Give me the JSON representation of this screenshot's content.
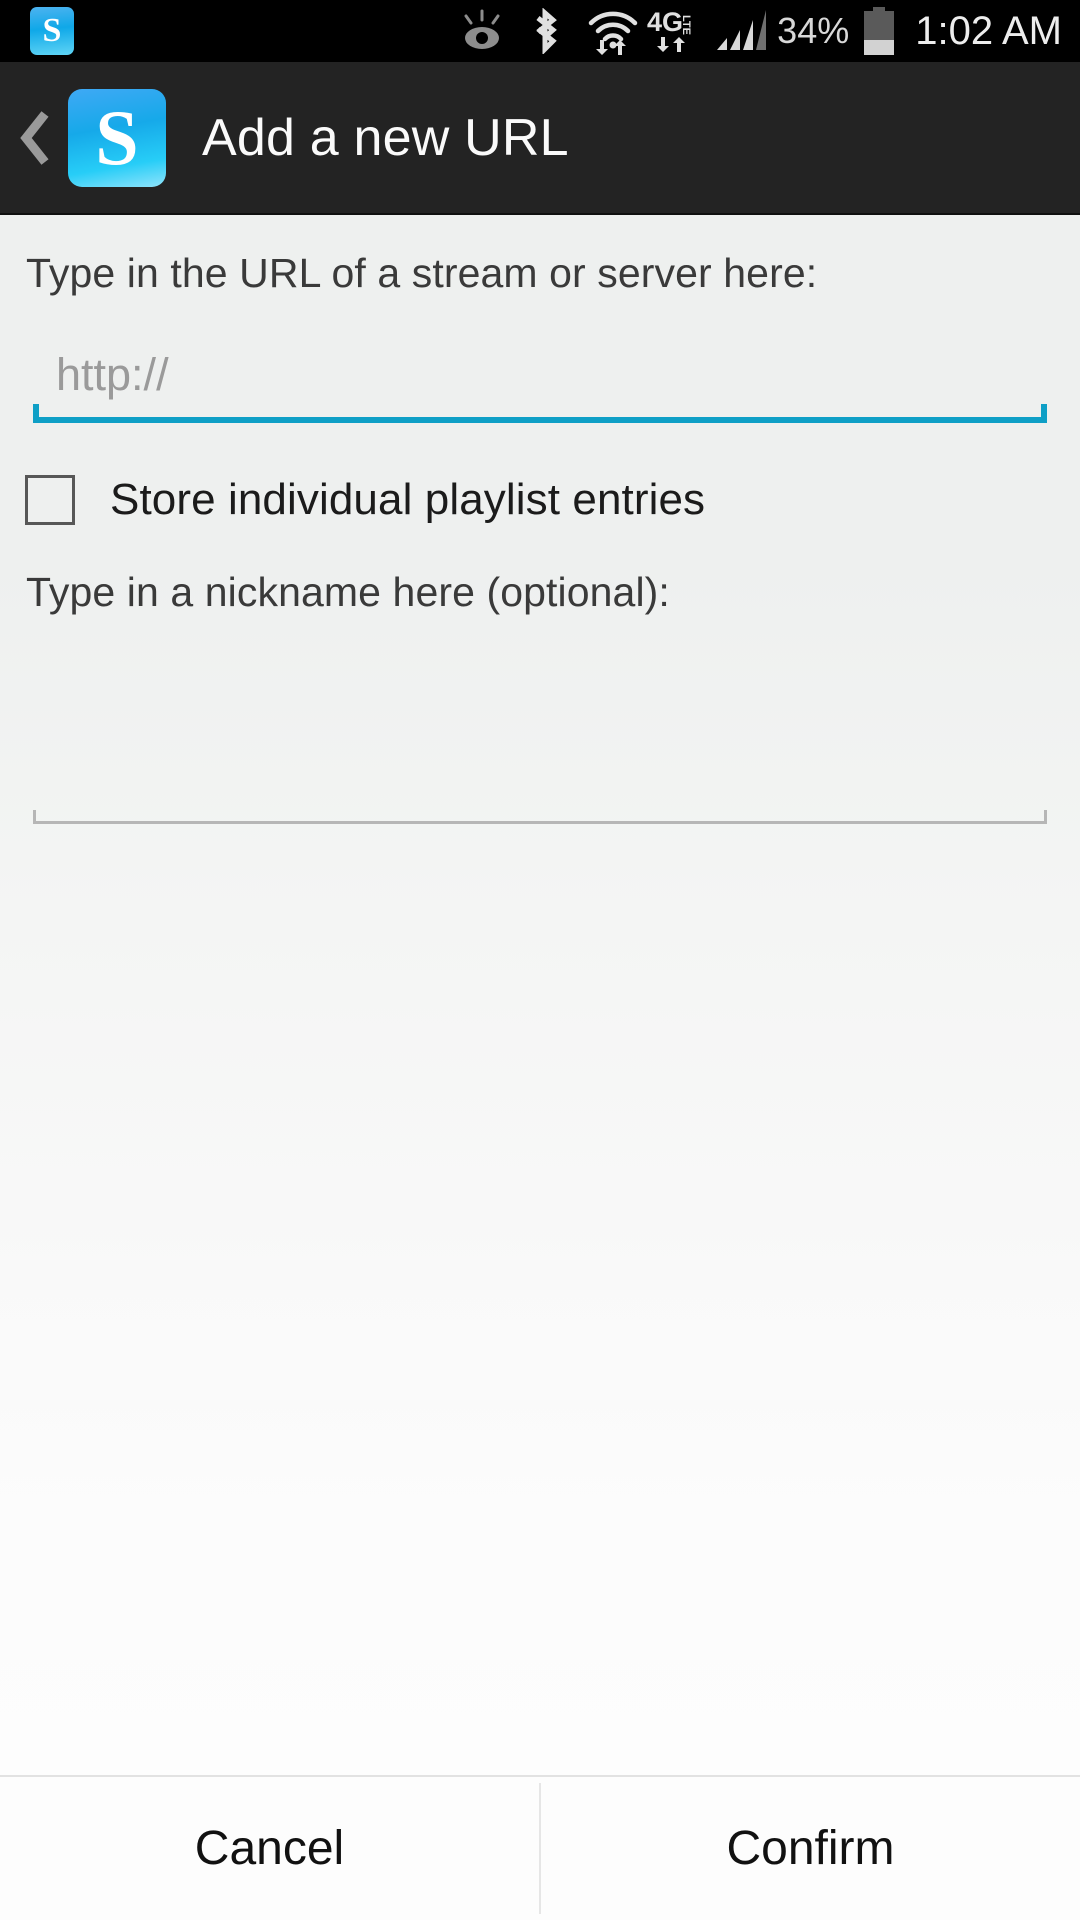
{
  "status_bar": {
    "app_icon": "servestream-notification-icon",
    "app_icon_letter": "S",
    "icons": [
      "smart-stay-eye-icon",
      "bluetooth-icon",
      "wifi-icon",
      "4g-lte-icon",
      "signal-bars-icon"
    ],
    "battery_percent": "34%",
    "battery_level": 34,
    "time": "1:02 AM",
    "lte_label": "4G",
    "lte_sublabel": "LTE",
    "background": "#000000"
  },
  "action_bar": {
    "back_icon": "back-chevron-icon",
    "app_icon": "servestream-app-icon",
    "app_icon_letter": "S",
    "title": "Add a new URL",
    "background": "#232323"
  },
  "form": {
    "url_label": "Type in the URL of a stream or server here:",
    "url_input": {
      "value": "",
      "placeholder": "http://",
      "focused": true,
      "accent_color": "#0e9fc6"
    },
    "checkbox": {
      "label": "Store individual playlist entries",
      "checked": false
    },
    "nickname_label": "Type in a nickname here (optional):",
    "nickname_input": {
      "value": "",
      "placeholder": "",
      "focused": false,
      "line_color": "#b6b6b6"
    }
  },
  "buttons": {
    "cancel": "Cancel",
    "confirm": "Confirm"
  }
}
